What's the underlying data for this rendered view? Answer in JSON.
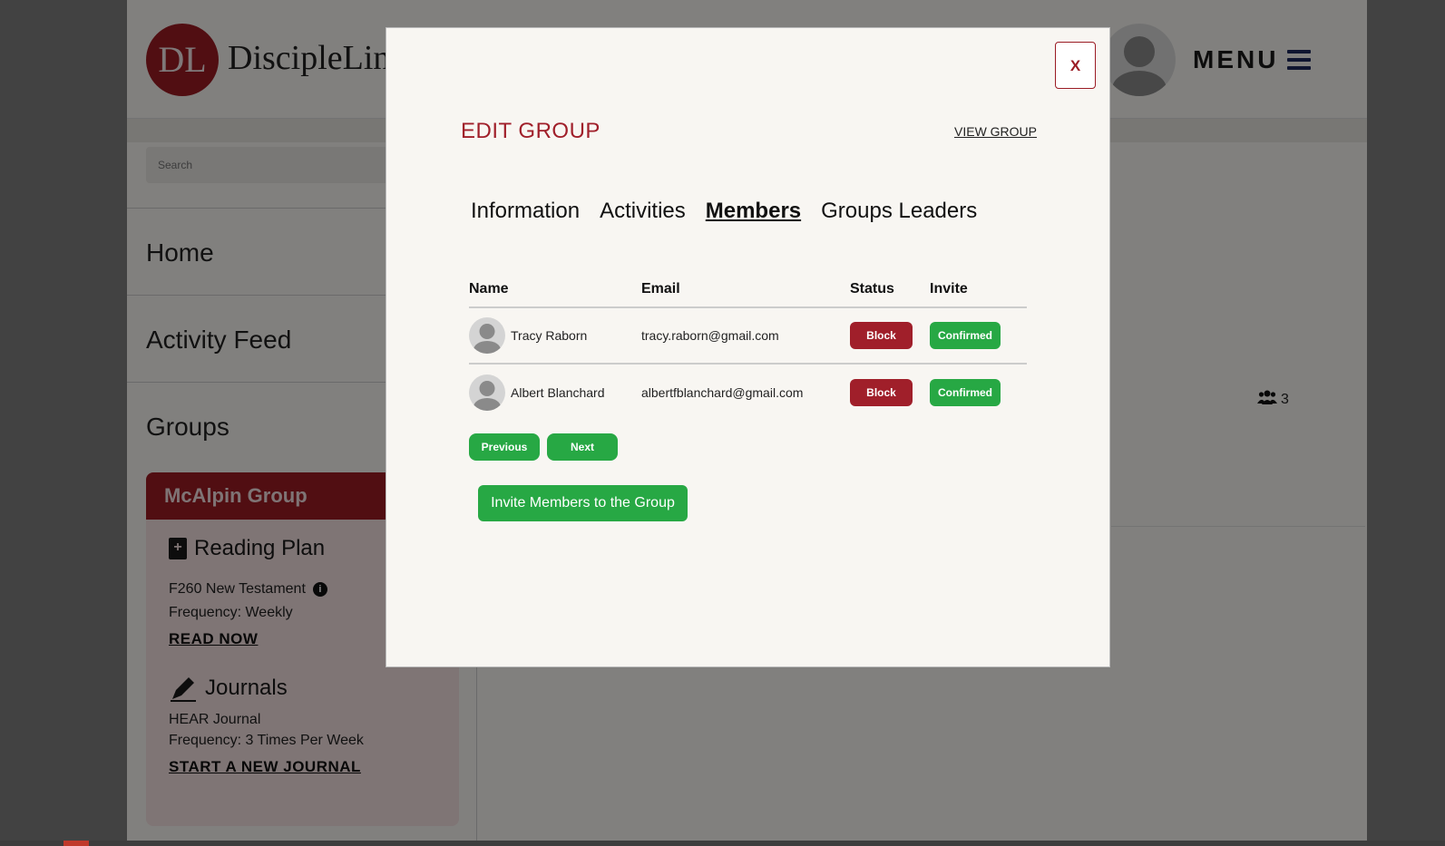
{
  "header": {
    "logo_text": "DL",
    "brand": "DiscipleLink",
    "menu_label": "MENU"
  },
  "sidebar": {
    "search_placeholder": "Search",
    "nav": [
      {
        "label": "Home"
      },
      {
        "label": "Activity Feed"
      },
      {
        "label": "Groups"
      }
    ],
    "group_card": {
      "title": "McAlpin Group",
      "reading_plan": {
        "heading": "Reading Plan",
        "plan_name": "F260 New Testament",
        "frequency": "Frequency: Weekly",
        "link": "READ NOW"
      },
      "journals": {
        "heading": "Journals",
        "journal_name": "HEAR Journal",
        "frequency": "Frequency: 3 Times Per Week",
        "link": "START A NEW JOURNAL"
      }
    }
  },
  "main": {
    "member_count": "3"
  },
  "modal": {
    "close_label": "X",
    "title": "EDIT GROUP",
    "view_group_link": "VIEW GROUP",
    "tabs": [
      {
        "label": "Information",
        "active": false
      },
      {
        "label": "Activities",
        "active": false
      },
      {
        "label": "Members",
        "active": true
      },
      {
        "label": "Groups Leaders",
        "active": false
      }
    ],
    "table": {
      "columns": [
        "Name",
        "Email",
        "Status",
        "Invite"
      ],
      "rows": [
        {
          "name": "Tracy Raborn",
          "email": "tracy.raborn@gmail.com",
          "status": "Block",
          "invite": "Confirmed"
        },
        {
          "name": "Albert Blanchard",
          "email": "albertfblanchard@gmail.com",
          "status": "Block",
          "invite": "Confirmed"
        }
      ]
    },
    "pager": {
      "previous": "Previous",
      "next": "Next"
    },
    "invite_button": "Invite Members to the Group"
  },
  "colors": {
    "brand_red": "#9b1c24",
    "success_green": "#27a844",
    "modal_bg": "#f8f6f2",
    "overlay": "rgba(0,0,0,0.48)"
  },
  "icons": [
    "user-avatar-icon",
    "hamburger-icon",
    "bible-icon",
    "info-icon",
    "pen-icon",
    "users-icon",
    "close-icon"
  ]
}
